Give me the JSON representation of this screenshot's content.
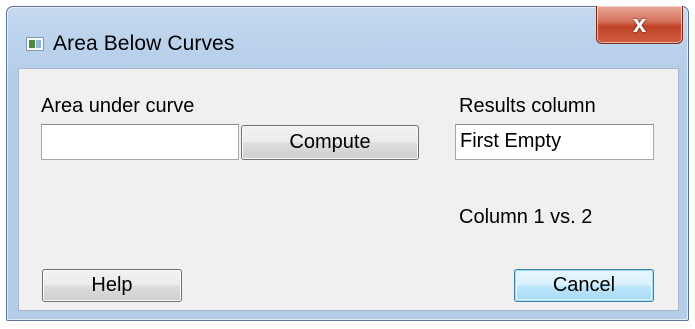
{
  "window": {
    "title": "Area Below Curves",
    "close_glyph": "x"
  },
  "area": {
    "label": "Area under curve",
    "value": ""
  },
  "compute_button": {
    "label": "Compute"
  },
  "results": {
    "label": "Results column",
    "value": "First Empty"
  },
  "column_info": "Column 1 vs. 2",
  "help_button": {
    "label": "Help"
  },
  "cancel_button": {
    "label": "Cancel"
  },
  "icons": {
    "app": "app-window-icon",
    "close": "close-icon"
  },
  "colors": {
    "titlebar": "#bcd3ec",
    "close_button": "#c1442a",
    "dialog_body": "#f0f0f0",
    "default_button_border": "#3c7fb1"
  }
}
